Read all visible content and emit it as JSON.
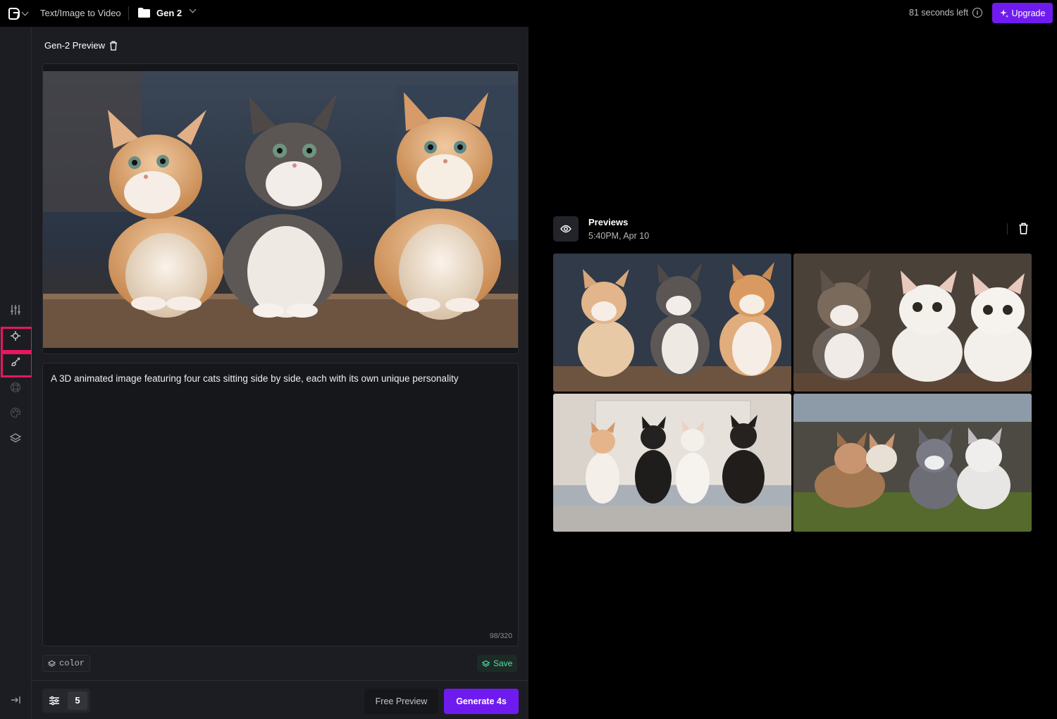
{
  "topbar": {
    "crumb_tool": "Text/Image to Video",
    "crumb_project": "Gen 2",
    "time_left": "81 seconds left",
    "upgrade_label": "Upgrade"
  },
  "panel": {
    "title": "Gen-2 Preview",
    "prompt": "A 3D animated image featuring four cats sitting side by side, each with its own unique personality",
    "char_count": "98/320",
    "style_chip": "color",
    "save_label": "Save",
    "preview_count": "5",
    "free_preview_label": "Free Preview",
    "generate_label": "Generate 4s"
  },
  "previews": {
    "title": "Previews",
    "date": "5:40PM, Apr 10"
  },
  "colors": {
    "accent": "#6f1bf0",
    "highlight": "#e8175d",
    "save_green": "#4ee0a6"
  }
}
